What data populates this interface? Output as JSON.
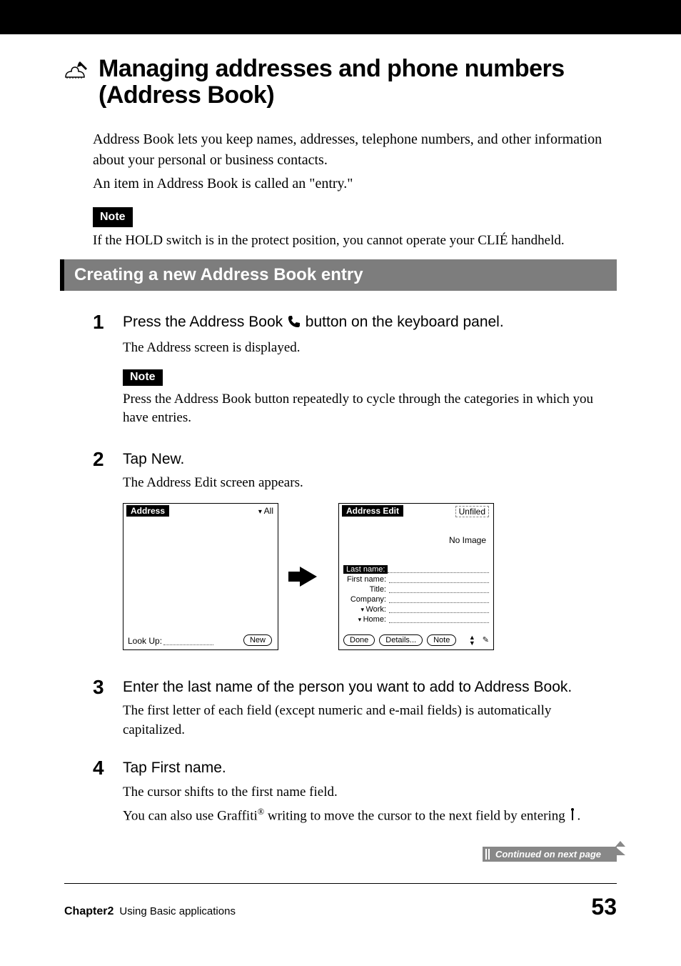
{
  "title": "Managing addresses and phone numbers (Address Book)",
  "intro": {
    "p1": "Address Book lets you keep names, addresses, telephone numbers, and other information about your personal or business contacts.",
    "p2": "An item in Address Book is called an \"entry.\""
  },
  "note_label": "Note",
  "note_text": "If the HOLD switch is in the protect position, you cannot operate your CLIÉ handheld.",
  "section_title": "Creating a new Address Book entry",
  "steps": {
    "s1": {
      "num": "1",
      "lead_pre": "Press the Address Book ",
      "lead_post": " button on the keyboard panel.",
      "desc": "The Address screen is displayed.",
      "note_label": "Note",
      "note_text": "Press the Address Book button repeatedly to cycle through the categories in which you have entries."
    },
    "s2": {
      "num": "2",
      "lead": "Tap New.",
      "desc": "The Address Edit screen appears."
    },
    "s3": {
      "num": "3",
      "lead": "Enter the last name of the person you want to add to Address Book.",
      "desc": "The first letter of each field (except numeric and e-mail fields) is automatically capitalized."
    },
    "s4": {
      "num": "4",
      "lead": "Tap First name.",
      "desc1": "The cursor shifts to the first name field.",
      "desc2a": "You can also use Graffiti",
      "desc2b": " writing to move the cursor to the next field by entering ",
      "desc2c": "."
    }
  },
  "screenshot1": {
    "title": "Address",
    "category": "All",
    "lookup": "Look Up:",
    "new_btn": "New"
  },
  "screenshot2": {
    "title": "Address Edit",
    "category": "Unfiled",
    "no_image": "No Image",
    "fields": {
      "lastname": "Last name:",
      "firstname": "First name:",
      "title_f": "Title:",
      "company": "Company:",
      "work": "Work:",
      "home": "Home:"
    },
    "buttons": {
      "done": "Done",
      "details": "Details...",
      "note": "Note"
    }
  },
  "continued": "Continued on next page",
  "footer": {
    "chapter": "Chapter2",
    "sub": "Using Basic applications",
    "page": "53"
  }
}
